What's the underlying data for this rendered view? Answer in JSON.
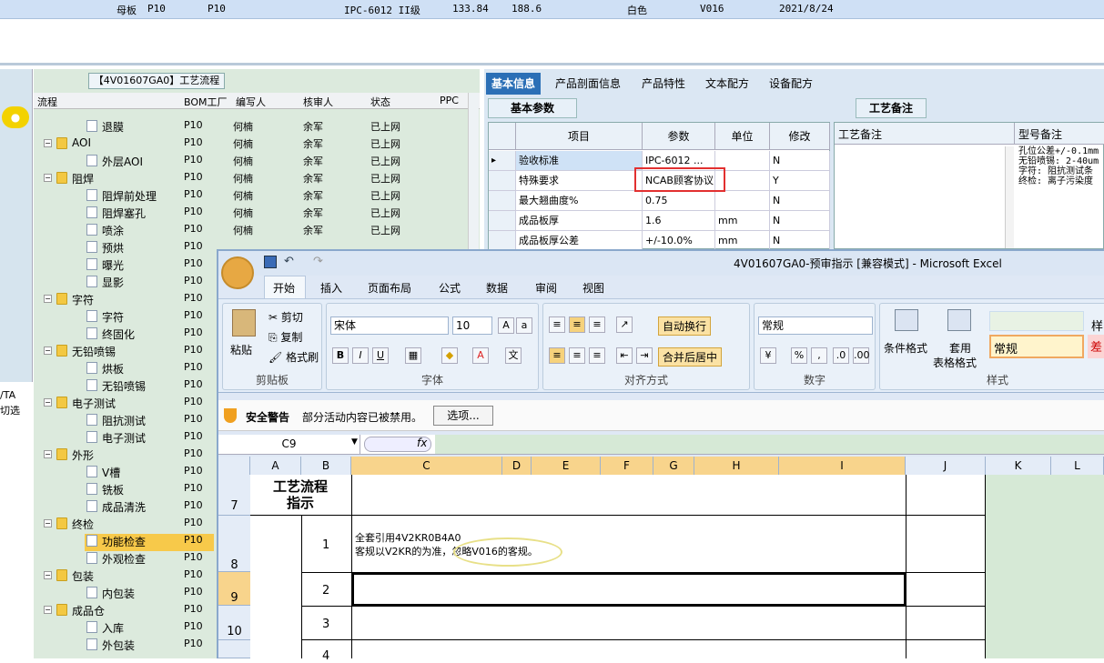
{
  "top_row": [
    "母板",
    "P10",
    "P10",
    "IPC-6012 II级",
    "133.84",
    "188.6",
    "白色",
    "V016",
    "2021/8/24"
  ],
  "tree_title": "【4V01607GA0】工艺流程",
  "tree_headers": [
    "流程",
    "BOM工厂",
    "编写人",
    "核审人",
    "状态",
    "PPC"
  ],
  "left_labels": [
    "/TA",
    "切选"
  ],
  "tree_rows": [
    {
      "label": "退膜",
      "type": "doc",
      "lvl": 2,
      "f": "P10",
      "w": "何楠",
      "r": "余军",
      "s": "已上网"
    },
    {
      "label": "AOI",
      "type": "folder",
      "lvl": 1,
      "f": "P10",
      "w": "何楠",
      "r": "余军",
      "s": "已上网"
    },
    {
      "label": "外层AOI",
      "type": "doc",
      "lvl": 2,
      "f": "P10",
      "w": "何楠",
      "r": "余军",
      "s": "已上网"
    },
    {
      "label": "阻焊",
      "type": "folder",
      "lvl": 1,
      "f": "P10",
      "w": "何楠",
      "r": "余军",
      "s": "已上网"
    },
    {
      "label": "阻焊前处理",
      "type": "doc",
      "lvl": 2,
      "f": "P10",
      "w": "何楠",
      "r": "余军",
      "s": "已上网"
    },
    {
      "label": "阻焊塞孔",
      "type": "doc",
      "lvl": 2,
      "f": "P10",
      "w": "何楠",
      "r": "余军",
      "s": "已上网"
    },
    {
      "label": "喷涂",
      "type": "doc",
      "lvl": 2,
      "f": "P10",
      "w": "何楠",
      "r": "余军",
      "s": "已上网"
    },
    {
      "label": "预烘",
      "type": "doc",
      "lvl": 2,
      "f": "P10",
      "w": "",
      "r": "",
      "s": ""
    },
    {
      "label": "曝光",
      "type": "doc",
      "lvl": 2,
      "f": "P10",
      "w": "",
      "r": "",
      "s": ""
    },
    {
      "label": "显影",
      "type": "doc",
      "lvl": 2,
      "f": "P10",
      "w": "",
      "r": "",
      "s": ""
    },
    {
      "label": "字符",
      "type": "folder",
      "lvl": 1,
      "f": "P10",
      "w": "",
      "r": "",
      "s": ""
    },
    {
      "label": "字符",
      "type": "doc",
      "lvl": 2,
      "f": "P10",
      "w": "",
      "r": "",
      "s": ""
    },
    {
      "label": "终固化",
      "type": "doc",
      "lvl": 2,
      "f": "P10",
      "w": "",
      "r": "",
      "s": ""
    },
    {
      "label": "无铅喷锡",
      "type": "folder",
      "lvl": 1,
      "f": "P10",
      "w": "",
      "r": "",
      "s": ""
    },
    {
      "label": "烘板",
      "type": "doc",
      "lvl": 2,
      "f": "P10",
      "w": "",
      "r": "",
      "s": ""
    },
    {
      "label": "无铅喷锡",
      "type": "doc",
      "lvl": 2,
      "f": "P10",
      "w": "",
      "r": "",
      "s": ""
    },
    {
      "label": "电子测试",
      "type": "folder",
      "lvl": 1,
      "f": "P10",
      "w": "",
      "r": "",
      "s": ""
    },
    {
      "label": "阻抗测试",
      "type": "doc",
      "lvl": 2,
      "f": "P10",
      "w": "",
      "r": "",
      "s": ""
    },
    {
      "label": "电子测试",
      "type": "doc",
      "lvl": 2,
      "f": "P10",
      "w": "",
      "r": "",
      "s": ""
    },
    {
      "label": "外形",
      "type": "folder",
      "lvl": 1,
      "f": "P10",
      "w": "",
      "r": "",
      "s": ""
    },
    {
      "label": "V槽",
      "type": "doc",
      "lvl": 2,
      "f": "P10",
      "w": "",
      "r": "",
      "s": ""
    },
    {
      "label": "铣板",
      "type": "doc",
      "lvl": 2,
      "f": "P10",
      "w": "",
      "r": "",
      "s": ""
    },
    {
      "label": "成品清洗",
      "type": "doc",
      "lvl": 2,
      "f": "P10",
      "w": "",
      "r": "",
      "s": ""
    },
    {
      "label": "终检",
      "type": "folder",
      "lvl": 1,
      "f": "P10",
      "w": "",
      "r": "",
      "s": ""
    },
    {
      "label": "功能检查",
      "type": "doc",
      "lvl": 2,
      "f": "P10",
      "w": "",
      "r": "",
      "s": ""
    },
    {
      "label": "外观检查",
      "type": "doc",
      "lvl": 2,
      "f": "P10",
      "w": "",
      "r": "",
      "s": ""
    },
    {
      "label": "包装",
      "type": "folder",
      "lvl": 1,
      "f": "P10",
      "w": "",
      "r": "",
      "s": ""
    },
    {
      "label": "内包装",
      "type": "doc",
      "lvl": 2,
      "f": "P10",
      "w": "",
      "r": "",
      "s": ""
    },
    {
      "label": "成品仓",
      "type": "folder",
      "lvl": 1,
      "f": "P10",
      "w": "",
      "r": "",
      "s": ""
    },
    {
      "label": "入库",
      "type": "doc",
      "lvl": 2,
      "f": "P10",
      "w": "",
      "r": "",
      "s": ""
    },
    {
      "label": "外包装",
      "type": "doc",
      "lvl": 2,
      "f": "P10",
      "w": "",
      "r": "",
      "s": ""
    }
  ],
  "right_tabs": [
    "基本信息",
    "产品剖面信息",
    "产品特性",
    "文本配方",
    "设备配方"
  ],
  "basic_tab": "基本参数",
  "remark_tab": "工艺备注",
  "param_headers": [
    "项目",
    "参数",
    "单位",
    "修改"
  ],
  "params": [
    {
      "item": "验收标准",
      "val": "IPC-6012 ...",
      "unit": "",
      "mod": "N"
    },
    {
      "item": "特殊要求",
      "val": "NCAB顾客协议",
      "unit": "",
      "mod": "Y"
    },
    {
      "item": "最大翘曲度%",
      "val": "0.75",
      "unit": "",
      "mod": "N"
    },
    {
      "item": "成品板厚",
      "val": "1.6",
      "unit": "mm",
      "mod": "N"
    },
    {
      "item": "成品板厚公差",
      "val": "+/-10.0%",
      "unit": "mm",
      "mod": "N"
    }
  ],
  "remark_headers": [
    "工艺备注",
    "型号备注"
  ],
  "model_remarks": [
    "孔位公差+/-0.1mm",
    "无铅喷锡: 2-40um",
    "字符: 阻抗测试条",
    "终检: 离子污染度"
  ],
  "excel": {
    "title": "4V01607GA0-预审指示  [兼容模式] - Microsoft Excel",
    "menus": [
      "开始",
      "插入",
      "页面布局",
      "公式",
      "数据",
      "审阅",
      "视图"
    ],
    "paste": "粘贴",
    "cut": "剪切",
    "copy": "复制",
    "painter": "格式刷",
    "clipboard": "剪贴板",
    "font_name": "宋体",
    "font_size": "10",
    "font_group": "字体",
    "wrap": "自动换行",
    "merge": "合并后居中",
    "align_group": "对齐方式",
    "numfmt": "常规",
    "num_group": "数字",
    "cond": "条件格式",
    "table1": "套用",
    "table2": "表格格式",
    "style_normal": "常规",
    "style_group": "样式",
    "style_right1": "样",
    "style_right2": "差",
    "sec_warn": "安全警告",
    "sec_msg": "部分活动内容已被禁用。",
    "sec_btn": "选项...",
    "namebox": "C9",
    "fx": "fx",
    "cols": [
      "A",
      "B",
      "C",
      "D",
      "E",
      "F",
      "G",
      "H",
      "I",
      "J",
      "K",
      "L"
    ],
    "rows": [
      "7",
      "8",
      "9",
      "10"
    ],
    "cell_title1": "工艺流程",
    "cell_title2": "指示",
    "nums": [
      "1",
      "2",
      "3",
      "4"
    ],
    "line1": "全套引用4V2KR0B4A0",
    "line2": "客规以V2KR的为准，",
    "line2b": "忽略V016的客规。"
  }
}
